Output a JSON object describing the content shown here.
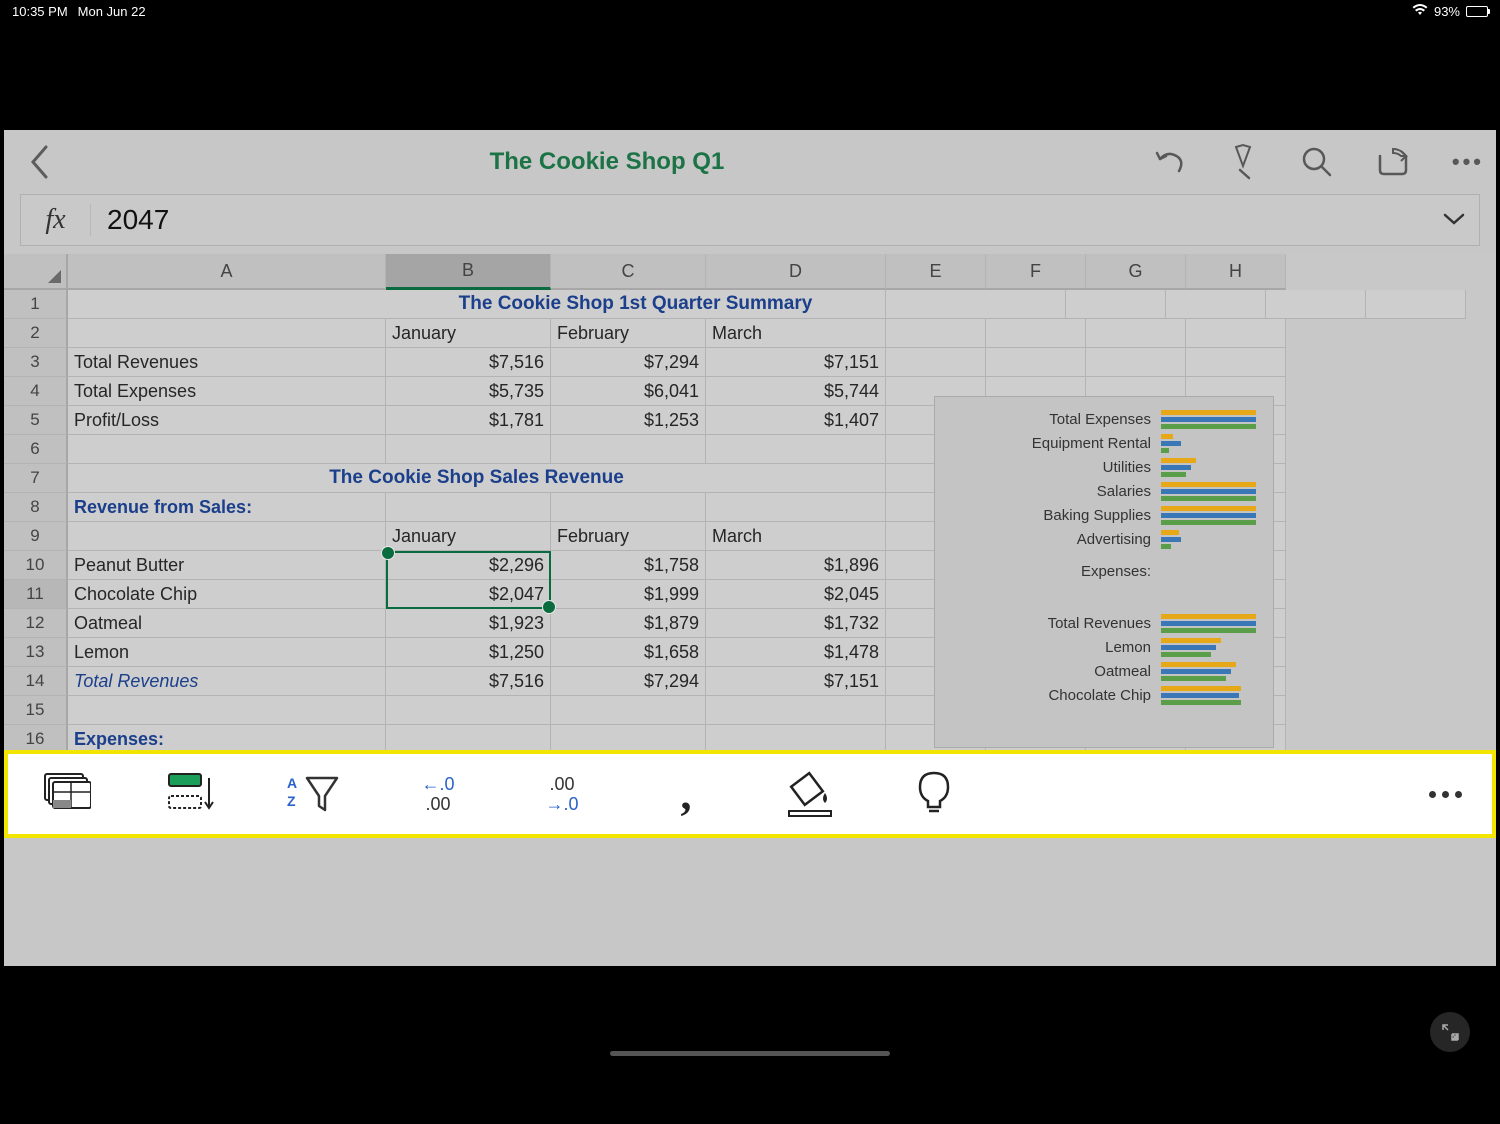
{
  "status": {
    "time": "10:35 PM",
    "date": "Mon Jun 22",
    "battery": "93%"
  },
  "header": {
    "title": "The Cookie Shop Q1"
  },
  "formula": {
    "fx": "fx",
    "value": "2047"
  },
  "columns": [
    "A",
    "B",
    "C",
    "D",
    "E",
    "F",
    "G",
    "H"
  ],
  "rows": {
    "r1": {
      "a": "",
      "title": "The Cookie Shop 1st Quarter Summary"
    },
    "r2": {
      "b": "January",
      "c": "February",
      "d": "March"
    },
    "r3": {
      "a": "Total Revenues",
      "b": "$7,516",
      "c": "$7,294",
      "d": "$7,151"
    },
    "r4": {
      "a": "Total Expenses",
      "b": "$5,735",
      "c": "$6,041",
      "d": "$5,744"
    },
    "r5": {
      "a": "Profit/Loss",
      "b": "$1,781",
      "c": "$1,253",
      "d": "$1,407"
    },
    "r7": {
      "title": "The Cookie Shop Sales Revenue"
    },
    "r8": {
      "a": "Revenue from Sales:"
    },
    "r9": {
      "b": "January",
      "c": "February",
      "d": "March"
    },
    "r10": {
      "a": "Peanut Butter",
      "b": "$2,296",
      "c": "$1,758",
      "d": "$1,896"
    },
    "r11": {
      "a": "Chocolate Chip",
      "b": "$2,047",
      "c": "$1,999",
      "d": "$2,045"
    },
    "r12": {
      "a": "Oatmeal",
      "b": "$1,923",
      "c": "$1,879",
      "d": "$1,732"
    },
    "r13": {
      "a": "Lemon",
      "b": "$1,250",
      "c": "$1,658",
      "d": "$1,478"
    },
    "r14": {
      "a": "Total Revenues",
      "b": "$7,516",
      "c": "$7,294",
      "d": "$7,151"
    },
    "r16": {
      "a": "Expenses:"
    }
  },
  "chart_labels": {
    "l1": "Total Expenses",
    "l2": "Equipment Rental",
    "l3": "Utilities",
    "l4": "Salaries",
    "l5": "Baking Supplies",
    "l6": "Advertising",
    "spacer": "",
    "l7": "Expenses:",
    "l8": "Total Revenues",
    "l9": "Lemon",
    "l10": "Oatmeal",
    "l11": "Chocolate Chip"
  },
  "toolbar": {
    "dec_left": "←.0\n.00",
    "dec_right": ".00\n→.0"
  },
  "selected_cell": "B11",
  "chart_data": {
    "type": "bar",
    "orientation": "horizontal",
    "note": "Partially visible horizontal grouped bar chart; values estimated from bar widths (arbitrary units).",
    "series_colors": [
      "#e6a817",
      "#3a77b6",
      "#5a9e4a"
    ],
    "groups": [
      {
        "label": "Total Expenses",
        "values": [
          100,
          100,
          100
        ]
      },
      {
        "label": "Equipment Rental",
        "values": [
          12,
          20,
          8
        ]
      },
      {
        "label": "Utilities",
        "values": [
          35,
          30,
          25
        ]
      },
      {
        "label": "Salaries",
        "values": [
          100,
          100,
          100
        ]
      },
      {
        "label": "Baking Supplies",
        "values": [
          100,
          100,
          100
        ]
      },
      {
        "label": "Advertising",
        "values": [
          18,
          20,
          10
        ]
      },
      {
        "label": "Expenses:",
        "values": []
      },
      {
        "label": "Total Revenues",
        "values": [
          100,
          100,
          100
        ]
      },
      {
        "label": "Lemon",
        "values": [
          60,
          55,
          50
        ]
      },
      {
        "label": "Oatmeal",
        "values": [
          75,
          70,
          65
        ]
      },
      {
        "label": "Chocolate Chip",
        "values": [
          80,
          78,
          80
        ]
      }
    ]
  }
}
